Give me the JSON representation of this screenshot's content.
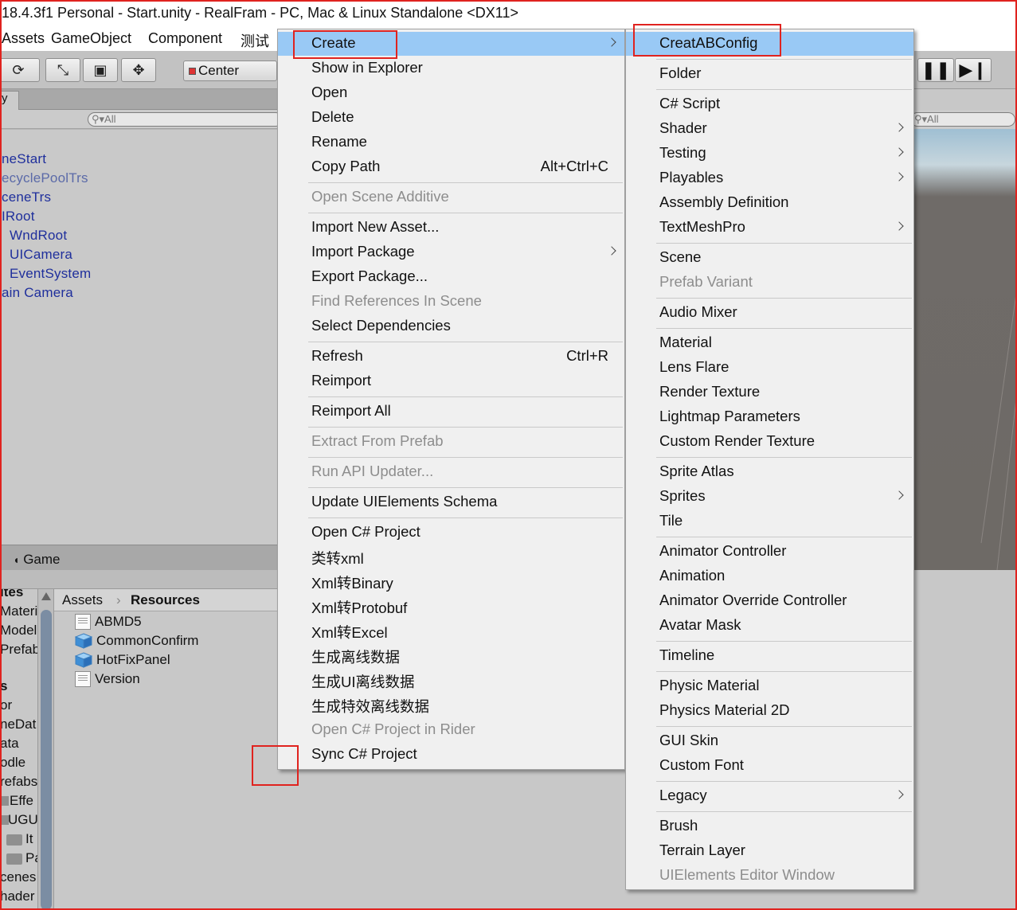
{
  "window_title": "18.4.3f1 Personal - Start.unity - RealFram - PC, Mac & Linux Standalone <DX11>",
  "menubar": [
    "Assets",
    "GameObject",
    "Component",
    "测试"
  ],
  "toolbar": {
    "pivot_label": "Center",
    "tool_icons": [
      "rotate-icon",
      "scale-icon",
      "rect-tool-icon",
      "transform-tool-icon"
    ],
    "play_icons": [
      "pause-icon",
      "step-icon"
    ]
  },
  "hierarchy": {
    "tab_label": "y",
    "search_placeholder": "All",
    "items": [
      "neStart",
      "ecyclePoolTrs",
      "ceneTrs",
      "IRoot",
      "WndRoot",
      "UICamera",
      "EventSystem",
      "ain Camera"
    ]
  },
  "game_tab": "Game",
  "project": {
    "left_items": [
      "ites",
      "Materi",
      "Model",
      "Prefab",
      "s",
      "or",
      "neDat",
      "ata",
      "odle",
      "refabs",
      "Effe",
      "UGU",
      "It",
      "Pa",
      "cenes",
      "hader"
    ],
    "breadcrumb": [
      "Assets",
      "Resources"
    ],
    "files": [
      {
        "name": "ABMD5",
        "icon": "text-file-icon"
      },
      {
        "name": "CommonConfirm",
        "icon": "prefab-icon"
      },
      {
        "name": "HotFixPanel",
        "icon": "prefab-icon"
      },
      {
        "name": "Version",
        "icon": "text-file-icon"
      }
    ]
  },
  "scene": {
    "search_placeholder": "All"
  },
  "context_menu": {
    "items": [
      {
        "label": "Create",
        "submenu": true,
        "highlighted": true
      },
      {
        "label": "Show in Explorer"
      },
      {
        "label": "Open"
      },
      {
        "label": "Delete"
      },
      {
        "label": "Rename"
      },
      {
        "label": "Copy Path",
        "shortcut": "Alt+Ctrl+C"
      },
      {
        "label": "Open Scene Additive",
        "disabled": true
      },
      {
        "label": "Import New Asset..."
      },
      {
        "label": "Import Package",
        "submenu": true
      },
      {
        "label": "Export Package..."
      },
      {
        "label": "Find References In Scene",
        "disabled": true
      },
      {
        "label": "Select Dependencies"
      },
      {
        "label": "Refresh",
        "shortcut": "Ctrl+R"
      },
      {
        "label": "Reimport"
      },
      {
        "label": "Reimport All"
      },
      {
        "label": "Extract From Prefab",
        "disabled": true
      },
      {
        "label": "Run API Updater...",
        "disabled": true
      },
      {
        "label": "Update UIElements Schema"
      },
      {
        "label": "Open C# Project"
      },
      {
        "label": "类转xml"
      },
      {
        "label": "Xml转Binary"
      },
      {
        "label": "Xml转Protobuf"
      },
      {
        "label": "Xml转Excel"
      },
      {
        "label": "生成离线数据"
      },
      {
        "label": "生成UI离线数据"
      },
      {
        "label": "生成特效离线数据"
      },
      {
        "label": "Open C# Project in Rider",
        "disabled": true
      },
      {
        "label": "Sync C# Project"
      }
    ]
  },
  "create_submenu": {
    "items": [
      {
        "label": "CreatABConfig",
        "highlighted": true
      },
      {
        "label": "Folder"
      },
      {
        "label": "C# Script"
      },
      {
        "label": "Shader",
        "submenu": true
      },
      {
        "label": "Testing",
        "submenu": true
      },
      {
        "label": "Playables",
        "submenu": true
      },
      {
        "label": "Assembly Definition"
      },
      {
        "label": "TextMeshPro",
        "submenu": true
      },
      {
        "label": "Scene"
      },
      {
        "label": "Prefab Variant",
        "disabled": true
      },
      {
        "label": "Audio Mixer"
      },
      {
        "label": "Material"
      },
      {
        "label": "Lens Flare"
      },
      {
        "label": "Render Texture"
      },
      {
        "label": "Lightmap Parameters"
      },
      {
        "label": "Custom Render Texture"
      },
      {
        "label": "Sprite Atlas"
      },
      {
        "label": "Sprites",
        "submenu": true
      },
      {
        "label": "Tile"
      },
      {
        "label": "Animator Controller"
      },
      {
        "label": "Animation"
      },
      {
        "label": "Animator Override Controller"
      },
      {
        "label": "Avatar Mask"
      },
      {
        "label": "Timeline"
      },
      {
        "label": "Physic Material"
      },
      {
        "label": "Physics Material 2D"
      },
      {
        "label": "GUI Skin"
      },
      {
        "label": "Custom Font"
      },
      {
        "label": "Legacy",
        "submenu": true
      },
      {
        "label": "Brush"
      },
      {
        "label": "Terrain Layer"
      },
      {
        "label": "UIElements Editor Window",
        "disabled": true
      }
    ]
  },
  "colors": {
    "menu_bg": "#f0f0f0",
    "menu_highlight": "#99c9f5",
    "annotation_red": "#e0231f",
    "hierarchy_text": "#1f2f9c"
  }
}
